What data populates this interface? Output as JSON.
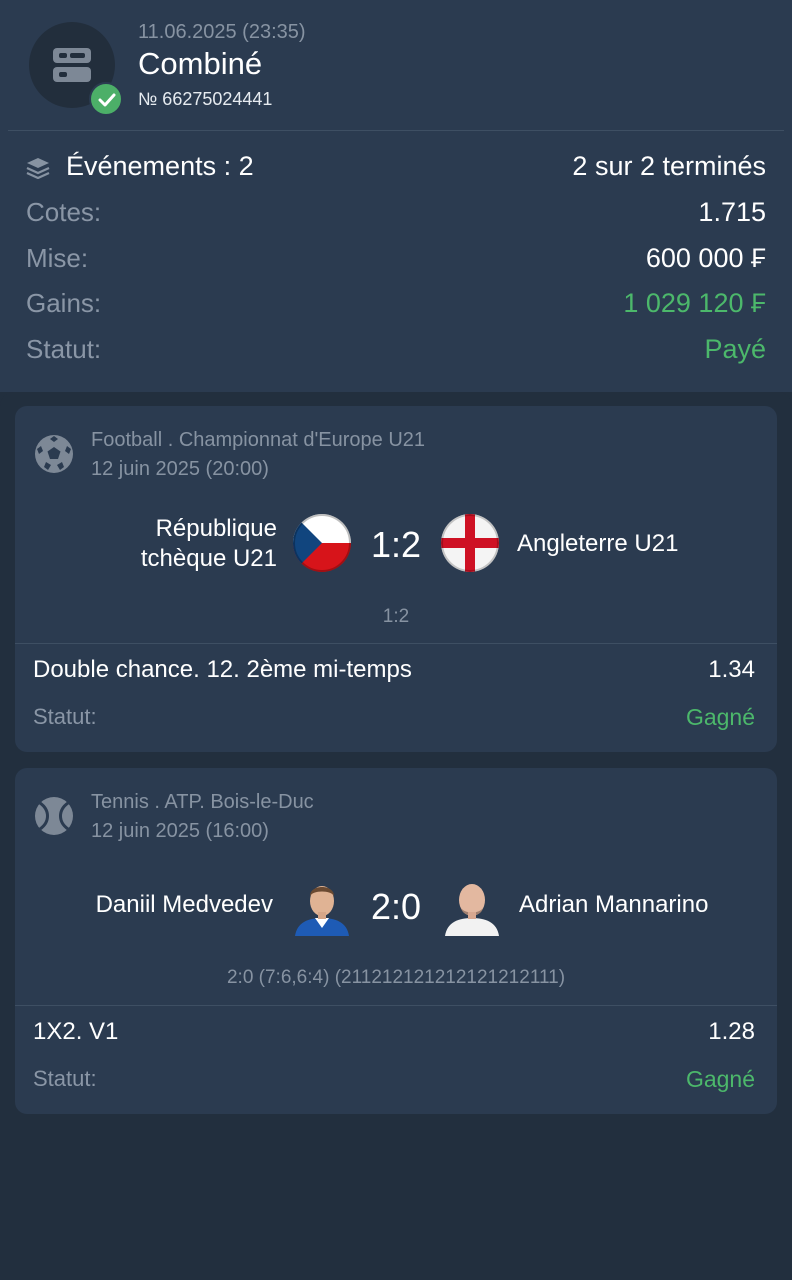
{
  "header": {
    "datetime": "11.06.2025 (23:35)",
    "title": "Combiné",
    "number": "№ 66275024441",
    "bet_icon": "coupon-icon",
    "status_icon": "check-icon"
  },
  "summary": {
    "events_label": "Événements : 2",
    "events_status": "2 sur 2 terminés",
    "rows": [
      {
        "label": "Cotes:",
        "value": "1.715"
      },
      {
        "label": "Mise:",
        "value": "600 000 ₣"
      },
      {
        "label": "Gains:",
        "value": "1 029 120 ₣"
      },
      {
        "label": "Statut:",
        "value": "Payé"
      }
    ]
  },
  "events": [
    {
      "sport_icon": "football-icon",
      "league": "Football . Championnat d'Europe U21",
      "date": "12 juin 2025 (20:00)",
      "team_home_line1": "République",
      "team_home_line2": "tchèque U21",
      "team_away": "Angleterre U21",
      "score": "1:2",
      "detail": "1:2",
      "bet": "Double chance. 12. 2ème mi-temps",
      "odd": "1.34",
      "status_label": "Statut:",
      "status_value": "Gagné"
    },
    {
      "sport_icon": "tennis-ball-icon",
      "league": "Tennis . ATP. Bois-le-Duc",
      "date": "12 juin 2025 (16:00)",
      "team_home": "Daniil Medvedev",
      "team_away": "Adrian Mannarino",
      "score": "2:0",
      "detail": "2:0 (7:6,6:4) (211212121212121212111)",
      "bet": "1X2. V1",
      "odd": "1.28",
      "status_label": "Statut:",
      "status_value": "Gagné"
    }
  ],
  "colors": {
    "background": "#222f3e",
    "card": "#2b3b50",
    "accent_green": "#4cb86b",
    "muted_text": "#8793a2"
  }
}
